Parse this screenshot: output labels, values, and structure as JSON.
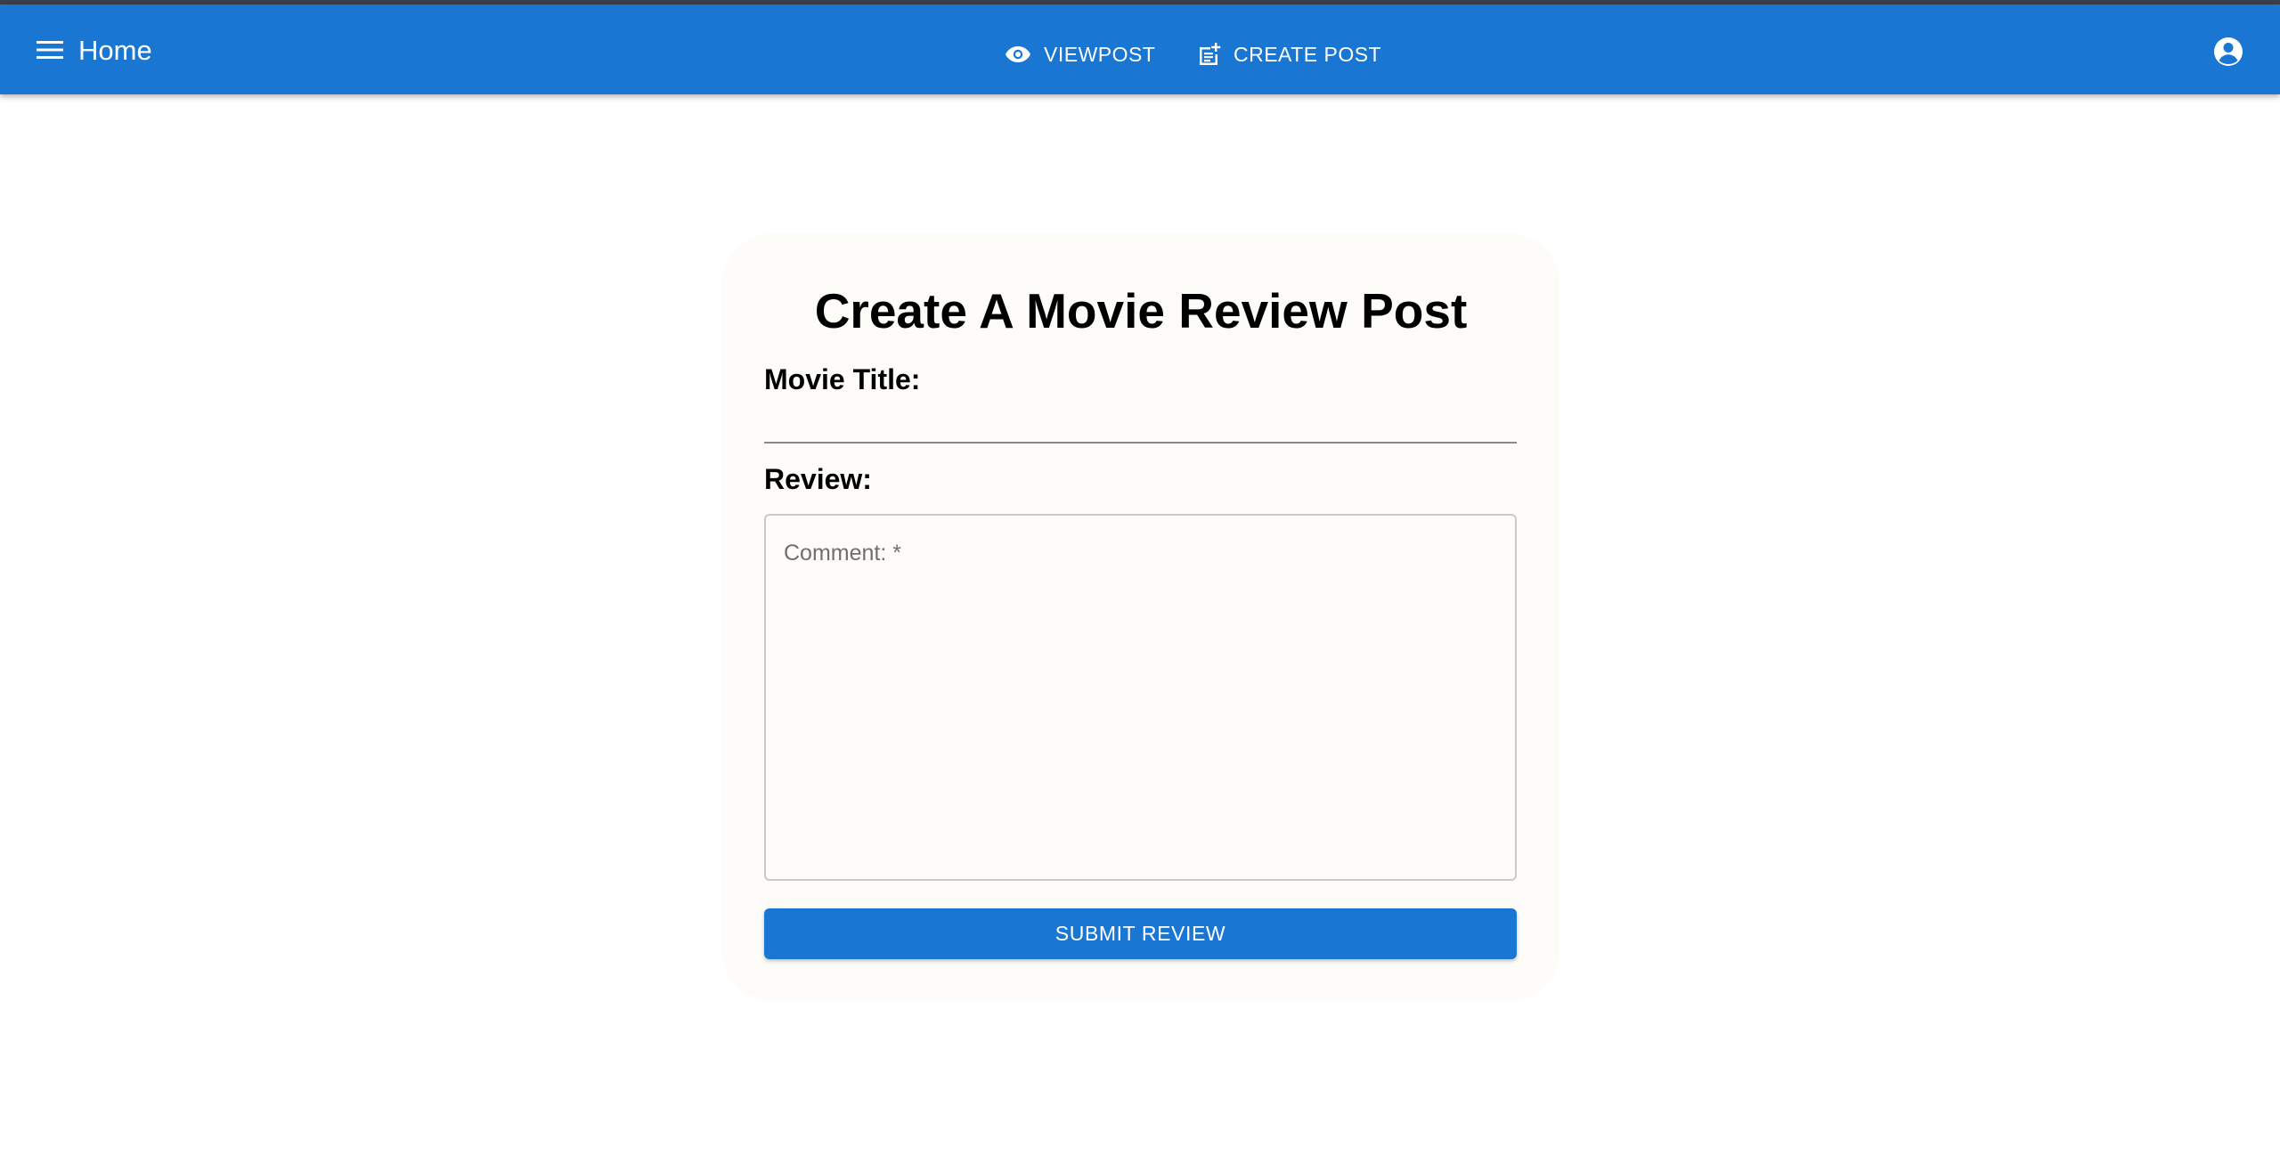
{
  "appbar": {
    "color": "#1976d2",
    "menu_icon": "hamburger-menu-icon",
    "home_label": "Home",
    "nav": [
      {
        "icon": "eye-icon",
        "label": "VIEWPOST"
      },
      {
        "icon": "post-add-icon",
        "label": "CREATE POST"
      }
    ],
    "account_icon": "account-circle-icon"
  },
  "form": {
    "heading": "Create A Movie Review Post",
    "movie_title_label": "Movie Title:",
    "movie_title_value": "",
    "review_label": "Review:",
    "comment_placeholder": "Comment: *",
    "submit_label": "SUBMIT REVIEW",
    "accent_color": "#1976d2"
  }
}
